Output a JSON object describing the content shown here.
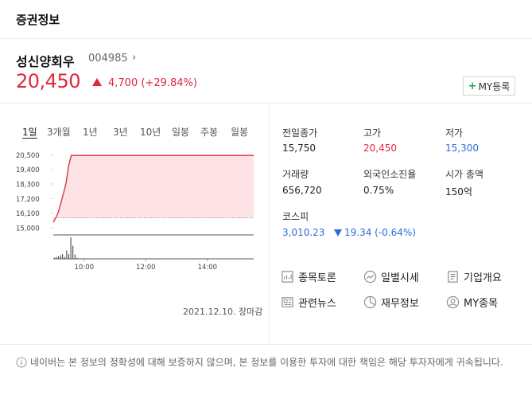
{
  "header": {
    "title": "증권정보"
  },
  "stock": {
    "name": "성신양회우",
    "code": "004985",
    "price": "20,450",
    "change": "4,700",
    "change_pct": "(+29.84%)",
    "my_button": "MY등록"
  },
  "tabs": [
    "1일",
    "3개월",
    "1년",
    "3년",
    "10년",
    "일봉",
    "주봉",
    "월봉"
  ],
  "chart_data": {
    "type": "line",
    "y_ticks": [
      "20,500",
      "19,400",
      "18,300",
      "17,200",
      "16,100",
      "15,000"
    ],
    "y_values": [
      20500,
      19400,
      18300,
      17200,
      16100,
      15000
    ],
    "x_ticks": [
      "10:00",
      "12:00",
      "14:00"
    ],
    "prev_close": 15750,
    "ylim": [
      14700,
      20700
    ],
    "x": [
      "09:00",
      "09:05",
      "09:10",
      "09:15",
      "09:20",
      "09:25",
      "09:30",
      "09:35",
      "09:40",
      "09:45",
      "15:30"
    ],
    "values": [
      15400,
      15750,
      16200,
      16900,
      17600,
      18400,
      19700,
      20450,
      20450,
      20450,
      20450
    ],
    "volume": [
      0.05,
      0.08,
      0.1,
      0.15,
      0.2,
      0.08,
      0.35,
      0.2,
      0.9,
      0.55,
      0.18,
      0.04,
      0.02
    ],
    "colors": {
      "line": "#e0263a",
      "fill": "#fde3e5",
      "prev": "#888888"
    }
  },
  "date": "2021.12.10. 장마감",
  "info": [
    {
      "label": "전일종가",
      "value": "15,750",
      "color": ""
    },
    {
      "label": "고가",
      "value": "20,450",
      "color": "red"
    },
    {
      "label": "저가",
      "value": "15,300",
      "color": "blue"
    },
    {
      "label": "거래량",
      "value": "656,720",
      "color": ""
    },
    {
      "label": "외국인소진율",
      "value": "0.75%",
      "color": ""
    },
    {
      "label": "시가 총액",
      "value": "150억",
      "color": ""
    }
  ],
  "index": {
    "label": "코스피",
    "value": "3,010.23",
    "change": "19.34 (-0.64%)"
  },
  "links": [
    {
      "label": "종목토론",
      "icon": "chart-doc-icon"
    },
    {
      "label": "일별시세",
      "icon": "trend-circle-icon"
    },
    {
      "label": "기업개요",
      "icon": "list-doc-icon"
    },
    {
      "label": "관련뉴스",
      "icon": "news-icon"
    },
    {
      "label": "재무정보",
      "icon": "pie-icon"
    },
    {
      "label": "MY종목",
      "icon": "user-circle-icon"
    }
  ],
  "notice": "네이버는 본 정보의 정확성에 대해 보증하지 않으며, 본 정보를 이용한 투자에 대한 책임은 해당 투자자에게 귀속됩니다."
}
